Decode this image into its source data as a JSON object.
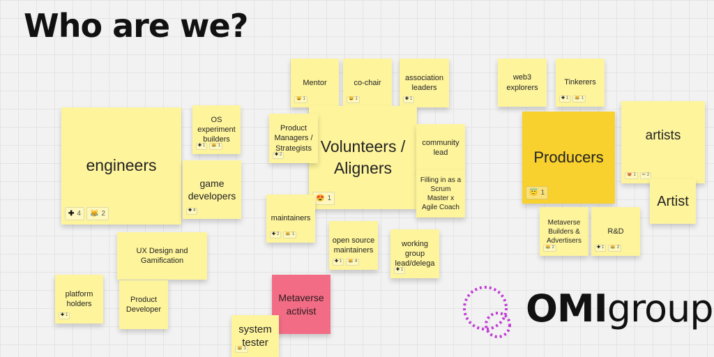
{
  "board_title": "Who are we?",
  "logo": {
    "bold": "OMI",
    "light": "group",
    "ring_color": "#c13ad6"
  },
  "notes": {
    "engineers": {
      "label": "engineers",
      "reactions": [
        {
          "icon": "plus-icon",
          "glyph": "✚",
          "count": "4"
        },
        {
          "icon": "laugh-emoji-icon",
          "glyph": "😹",
          "count": "2"
        }
      ]
    },
    "os_experiment": {
      "label": "OS\nexperiment\nbuilders",
      "reactions": [
        {
          "icon": "plus-icon",
          "glyph": "✚",
          "count": "1"
        },
        {
          "icon": "cat-emoji-icon",
          "glyph": "😹",
          "count": "1"
        }
      ]
    },
    "game_developers": {
      "label": "game\ndevelopers",
      "reactions": [
        {
          "icon": "plus-icon",
          "glyph": "✚",
          "count": "4"
        }
      ]
    },
    "ux_design": {
      "label": "UX Design and\nGamification"
    },
    "platform_holders": {
      "label": "platform\nholders",
      "reactions": [
        {
          "icon": "plus-icon",
          "glyph": "✚",
          "count": "1"
        }
      ]
    },
    "product_developer": {
      "label": "Product\nDeveloper"
    },
    "mentor": {
      "label": "Mentor",
      "reactions": [
        {
          "icon": "emoji-icon",
          "glyph": "😄",
          "count": "1"
        }
      ]
    },
    "co_chair": {
      "label": "co-chair",
      "reactions": [
        {
          "icon": "emoji-icon",
          "glyph": "😄",
          "count": "1"
        }
      ]
    },
    "association_leaders": {
      "label": "association\nleaders",
      "reactions": [
        {
          "icon": "plus-icon",
          "glyph": "✚",
          "count": "1"
        }
      ]
    },
    "product_managers": {
      "label": "Product\nManagers /\nStrategists",
      "reactions": [
        {
          "icon": "plus-icon",
          "glyph": "✚",
          "count": "2"
        }
      ]
    },
    "volunteers": {
      "label": "Volunteers /\nAligners",
      "reactions": [
        {
          "icon": "heart-eyes-emoji-icon",
          "glyph": "😍",
          "count": "1"
        }
      ]
    },
    "community_lead": {
      "label": "community\nlead"
    },
    "filling_in": {
      "label": "Filling in as a\nScrum\nMaster x\nAgile Coach"
    },
    "maintainers": {
      "label": "maintainers",
      "reactions": [
        {
          "icon": "plus-icon",
          "glyph": "✚",
          "count": "2"
        },
        {
          "icon": "emoji-icon",
          "glyph": "😹",
          "count": "1"
        }
      ]
    },
    "open_source_maintainers": {
      "label": "open source\nmaintainers",
      "reactions": [
        {
          "icon": "plus-icon",
          "glyph": "✚",
          "count": "1"
        },
        {
          "icon": "emoji-icon",
          "glyph": "😹",
          "count": "4"
        }
      ]
    },
    "working_group": {
      "label": "working\ngroup\nlead/delega",
      "reactions": [
        {
          "icon": "plus-icon",
          "glyph": "✚",
          "count": "1"
        }
      ]
    },
    "metaverse_activist": {
      "label": "Metaverse\nactivist"
    },
    "system_tester": {
      "label": "system\ntester",
      "reactions": [
        {
          "icon": "emoji-icon",
          "glyph": "😹",
          "count": "1"
        }
      ]
    },
    "web3_explorers": {
      "label": "web3\nexplorers"
    },
    "tinkerers": {
      "label": "Tinkerers",
      "reactions": [
        {
          "icon": "plus-icon",
          "glyph": "✚",
          "count": "1"
        },
        {
          "icon": "emoji-icon",
          "glyph": "😹",
          "count": "1"
        }
      ]
    },
    "producers": {
      "label": "Producers",
      "reactions": [
        {
          "icon": "smile-emoji-icon",
          "glyph": "😇",
          "count": "1"
        }
      ]
    },
    "artists": {
      "label": "artists",
      "reactions": [
        {
          "icon": "heart-eyes-emoji-icon",
          "glyph": "😻",
          "count": "1"
        },
        {
          "icon": "pencil-icon",
          "glyph": "✏",
          "count": "2"
        }
      ]
    },
    "artist": {
      "label": "Artist"
    },
    "metaverse_builders": {
      "label": "Metaverse\nBuilders &\nAdvertisers",
      "reactions": [
        {
          "icon": "emoji-icon",
          "glyph": "😹",
          "count": "2"
        }
      ]
    },
    "rnd": {
      "label": "R&D",
      "reactions": [
        {
          "icon": "plus-icon",
          "glyph": "✚",
          "count": "1"
        },
        {
          "icon": "emoji-icon",
          "glyph": "😹",
          "count": "2"
        }
      ]
    }
  }
}
